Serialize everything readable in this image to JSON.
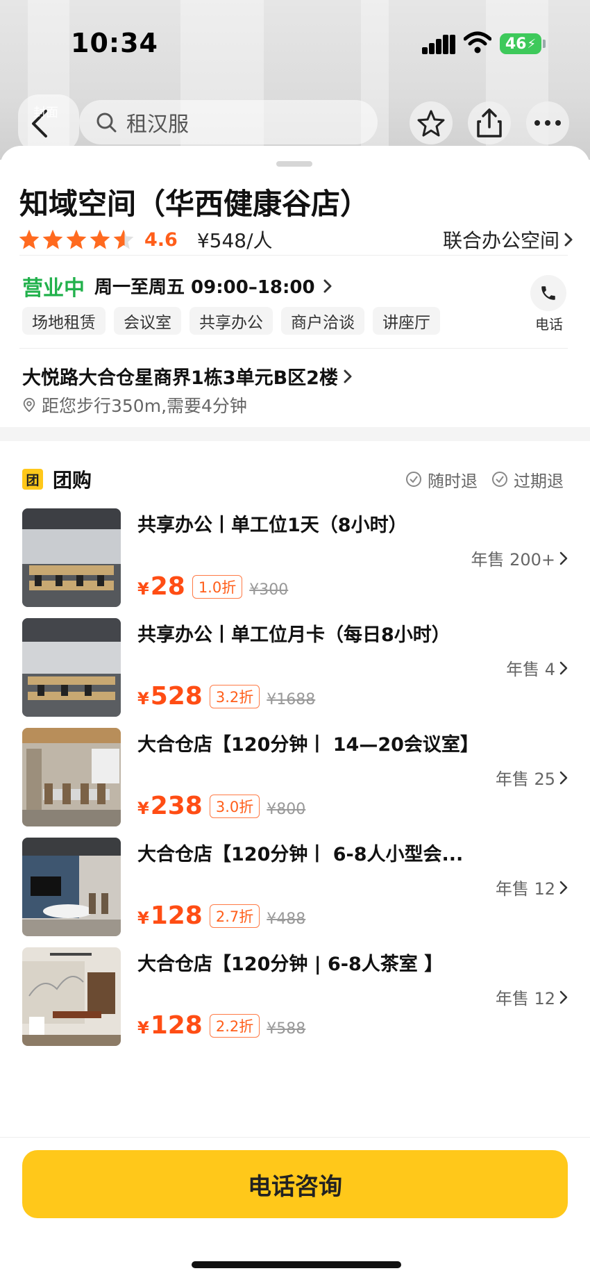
{
  "status_bar": {
    "time": "10:34",
    "battery": "46"
  },
  "nav": {
    "back_overlay_label": "封面",
    "search_text": "租汉服"
  },
  "store": {
    "name": "知域空间（华西健康谷店）",
    "rating": "4.6",
    "avg_price": "¥548/人",
    "category": "联合办公空间",
    "open_status": "营业中",
    "hours": "周一至周五 09:00–18:00",
    "phone_label": "电话",
    "tags": [
      "场地租赁",
      "会议室",
      "共享办公",
      "商户洽谈",
      "讲座厅"
    ],
    "address": "大悦路大合仓星商界1栋3单元B区2楼",
    "distance": "距您步行350m,需要4分钟"
  },
  "deals_section": {
    "badge": "团",
    "title": "团购",
    "refund_anytime": "随时退",
    "refund_expired": "过期退",
    "currency": "¥",
    "items": [
      {
        "name": "共享办公丨单工位1天（8小时）",
        "sold": "年售 200+",
        "price": "28",
        "discount": "1.0折",
        "original": "¥300"
      },
      {
        "name": "共享办公丨单工位月卡（每日8小时）",
        "sold": "年售 4",
        "price": "528",
        "discount": "3.2折",
        "original": "¥1688"
      },
      {
        "name": "大合仓店【120分钟丨 14—20会议室】",
        "sold": "年售 25",
        "price": "238",
        "discount": "3.0折",
        "original": "¥800"
      },
      {
        "name": "大合仓店【120分钟丨 6-8人小型会...",
        "sold": "年售 12",
        "price": "128",
        "discount": "2.7折",
        "original": "¥488"
      },
      {
        "name": "大合仓店【120分钟 | 6-8人茶室 】",
        "sold": "年售 12",
        "price": "128",
        "discount": "2.2折",
        "original": "¥588"
      }
    ]
  },
  "cta": {
    "label": "电话咨询"
  },
  "colors": {
    "accent": "#ffc81a",
    "price": "#ff4d14",
    "open": "#22b14c",
    "star": "#ff6a1f"
  }
}
